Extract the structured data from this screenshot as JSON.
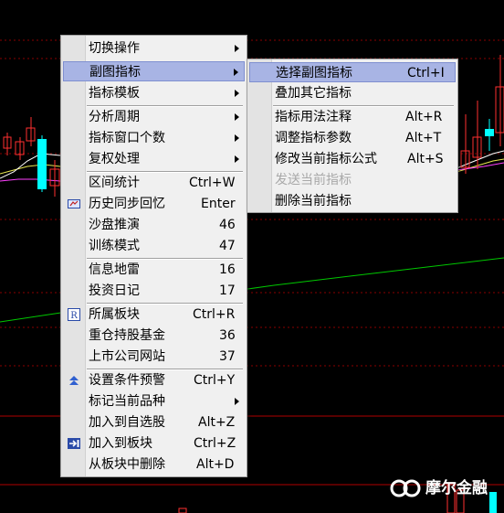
{
  "main_menu": {
    "items": [
      {
        "label": "切换操作",
        "shortcut": "",
        "submenu": true
      },
      {
        "label": "副图指标",
        "shortcut": "",
        "submenu": true,
        "highlighted": true
      },
      {
        "label": "指标模板",
        "shortcut": "",
        "submenu": true
      },
      {
        "label": "分析周期",
        "shortcut": "",
        "submenu": true
      },
      {
        "label": "指标窗口个数",
        "shortcut": "",
        "submenu": true
      },
      {
        "label": "复权处理",
        "shortcut": "",
        "submenu": true
      },
      {
        "label": "区间统计",
        "shortcut": "Ctrl+W"
      },
      {
        "label": "历史同步回忆",
        "shortcut": "Enter",
        "icon": "history-icon"
      },
      {
        "label": "沙盘推演",
        "shortcut": "46"
      },
      {
        "label": "训练模式",
        "shortcut": "47"
      },
      {
        "label": "信息地雷",
        "shortcut": "16"
      },
      {
        "label": "投资日记",
        "shortcut": "17"
      },
      {
        "label": "所属板块",
        "shortcut": "Ctrl+R",
        "icon": "r-box-icon"
      },
      {
        "label": "重仓持股基金",
        "shortcut": "36"
      },
      {
        "label": "上市公司网站",
        "shortcut": "37"
      },
      {
        "label": "设置条件预警",
        "shortcut": "Ctrl+Y",
        "icon": "double-up-arrow-icon"
      },
      {
        "label": "标记当前品种",
        "shortcut": "",
        "submenu": true
      },
      {
        "label": "加入到自选股",
        "shortcut": "Alt+Z"
      },
      {
        "label": "加入到板块",
        "shortcut": "Ctrl+Z",
        "icon": "add-to-block-icon"
      },
      {
        "label": "从板块中删除",
        "shortcut": "Alt+D"
      }
    ]
  },
  "sub_menu": {
    "items": [
      {
        "label": "选择副图指标",
        "shortcut": "Ctrl+I",
        "highlighted": true
      },
      {
        "label": "叠加其它指标",
        "shortcut": ""
      },
      {
        "label": "指标用法注释",
        "shortcut": "Alt+R"
      },
      {
        "label": "调整指标参数",
        "shortcut": "Alt+T"
      },
      {
        "label": "修改当前指标公式",
        "shortcut": "Alt+S"
      },
      {
        "label": "发送当前指标",
        "shortcut": "",
        "disabled": true
      },
      {
        "label": "删除当前指标",
        "shortcut": ""
      }
    ]
  },
  "brand": {
    "name": "摩尔金融"
  },
  "colors": {
    "menu_bg": "#f0f0f0",
    "highlight": "#a8b4e4",
    "chart_bg": "#000000",
    "candle_up": "#ff3030",
    "candle_down": "#00ffff",
    "ma_green": "#00c800",
    "gridline": "#7a0000"
  }
}
